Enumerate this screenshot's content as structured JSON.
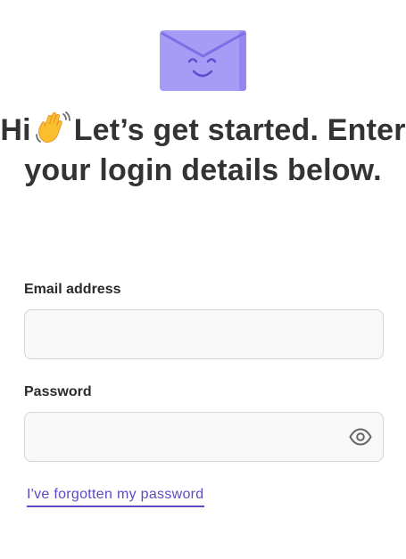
{
  "logo": {
    "icon": "smiling-envelope-icon",
    "color": "#a79cf5",
    "accent": "#7b6ee6"
  },
  "heading": {
    "before_emoji": "Hi",
    "emoji": "waving-hand-icon",
    "after_emoji": "Let’s get started. Enter your login details below."
  },
  "form": {
    "email_label": "Email address",
    "email_value": "",
    "password_label": "Password",
    "password_value": "",
    "password_toggle_icon": "eye-icon",
    "forgot_link": "I've forgotten my password"
  },
  "colors": {
    "text": "#333333",
    "link": "#5a4bc2",
    "input_bg": "#f8f8f8",
    "input_border": "#d6d6d6"
  }
}
